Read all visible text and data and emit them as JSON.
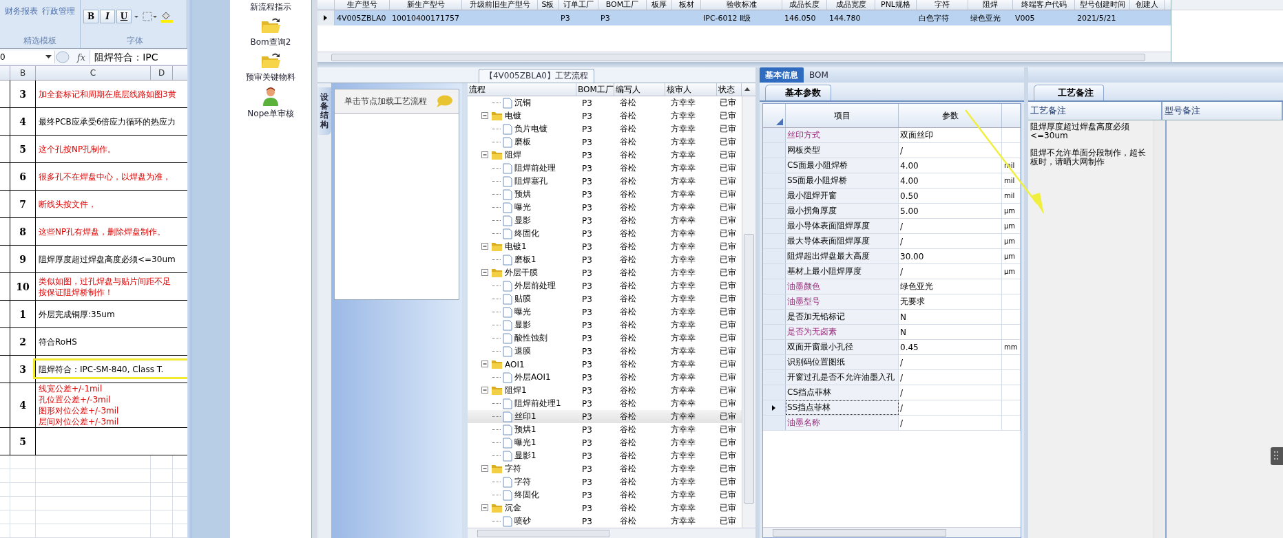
{
  "spreadsheet": {
    "ribbon": {
      "templates": {
        "items": [
          "财务报表",
          "行政管理"
        ],
        "label": "精选模板"
      },
      "font": {
        "buttons": [
          "B",
          "I",
          "U"
        ],
        "label": "字体"
      }
    },
    "name_box": "0",
    "formula_icon": "fx",
    "formula": "阻焊符合：IPC",
    "columns": [
      "B",
      "C",
      "D"
    ],
    "rows": [
      {
        "number": "3",
        "lines": [
          "加全套标记和周期在底层线路如图3黄"
        ],
        "important": true,
        "highlighted": false
      },
      {
        "number": "4",
        "lines": [
          "最终PCB应承受6倍应力循环的热应力"
        ],
        "important": false,
        "highlighted": false
      },
      {
        "number": "5",
        "lines": [
          "这个孔按NP孔制作。"
        ],
        "important": true,
        "highlighted": false
      },
      {
        "number": "6",
        "lines": [
          "很多孔不在焊盘中心，以焊盘为准，"
        ],
        "important": true,
        "highlighted": false
      },
      {
        "number": "7",
        "lines": [
          "断线头按文件，"
        ],
        "important": true,
        "highlighted": false
      },
      {
        "number": "8",
        "lines": [
          "这些NP孔有焊盘，删除焊盘制作。"
        ],
        "important": true,
        "highlighted": false
      },
      {
        "number": "9",
        "lines": [
          "阻焊厚度超过焊盘高度必须<=30um"
        ],
        "important": false,
        "highlighted": false
      },
      {
        "number": "10",
        "lines": [
          "类似如图，过孔焊盘与贴片间距不足",
          "按保证阻焊桥制作！"
        ],
        "important": true,
        "highlighted": false
      },
      {
        "number": "1",
        "lines": [
          "外层完成铜厚:35um"
        ],
        "important": false,
        "highlighted": false
      },
      {
        "number": "2",
        "lines": [
          "符合RoHS"
        ],
        "important": false,
        "highlighted": false
      },
      {
        "number": "3",
        "lines": [
          "阻焊符合：IPC-SM-840, Class T."
        ],
        "important": false,
        "highlighted": true
      },
      {
        "number": "4",
        "lines": [
          "线宽公差+/-1mil",
          "孔位置公差+/-3mil",
          "图形对位公差+/-3mil",
          "层间对位公差+/-3mil"
        ],
        "important": true,
        "highlighted": false
      },
      {
        "number": "5",
        "highlighted": false
      }
    ]
  },
  "launcher": [
    {
      "label": "新流程指示",
      "kind": "label"
    },
    {
      "label": "Bom查询2",
      "kind": "folder"
    },
    {
      "label": "预审关键物料",
      "kind": "folder"
    },
    {
      "label": "Nope单审核",
      "kind": "user"
    }
  ],
  "model_grid": {
    "columns": [
      "生产型号",
      "新生产型号",
      "升级前旧生产型号",
      "S板",
      "订单工厂",
      "BOM工厂",
      "板厚",
      "板材",
      "验收标准",
      "成品长度",
      "成品宽度",
      "PNL规格",
      "字符",
      "阻焊",
      "终端客户代码",
      "型号创建时间",
      "创建人"
    ],
    "rows": [
      {
        "selected": true,
        "cells": [
          "4V005ZBLA0",
          "10010400171757",
          null,
          null,
          "P3",
          "P3",
          null,
          null,
          "IPC-6012 Ⅱ级",
          "146.050",
          "144.780",
          null,
          "白色字符",
          "绿色亚光",
          "V005",
          "2021/5/21",
          null
        ]
      }
    ]
  },
  "process_panel": {
    "title": "【4V005ZBLA0】工艺流程",
    "side_tab": "设备结构",
    "hint": "单击节点加载工艺流程",
    "columns": [
      "流程",
      "BOM工厂",
      "编写人",
      "核审人",
      "状态"
    ],
    "tree": [
      {
        "name": "沉铜",
        "kind": "step",
        "bom": "P3",
        "author": "谷松",
        "reviewer": "方幸幸",
        "status": "已审",
        "selected": false
      },
      {
        "name": "电镀",
        "kind": "group",
        "expanded": true,
        "bom": "P3",
        "author": "谷松",
        "reviewer": "方幸幸",
        "status": "已审",
        "selected": false,
        "children": [
          {
            "name": "负片电镀",
            "kind": "step",
            "bom": "P3",
            "author": "谷松",
            "reviewer": "方幸幸",
            "status": "已审",
            "selected": false
          },
          {
            "name": "磨板",
            "kind": "step",
            "bom": "P3",
            "author": "谷松",
            "reviewer": "方幸幸",
            "status": "已审",
            "selected": false
          }
        ]
      },
      {
        "name": "阻焊",
        "kind": "group",
        "expanded": true,
        "bom": "P3",
        "author": "谷松",
        "reviewer": "方幸幸",
        "status": "已审",
        "selected": false,
        "children": [
          {
            "name": "阻焊前处理",
            "kind": "step",
            "bom": "P3",
            "author": "谷松",
            "reviewer": "方幸幸",
            "status": "已审",
            "selected": false
          },
          {
            "name": "阻焊塞孔",
            "kind": "step",
            "bom": "P3",
            "author": "谷松",
            "reviewer": "方幸幸",
            "status": "已审",
            "selected": false
          },
          {
            "name": "预烘",
            "kind": "step",
            "bom": "P3",
            "author": "谷松",
            "reviewer": "方幸幸",
            "status": "已审",
            "selected": false
          },
          {
            "name": "曝光",
            "kind": "step",
            "bom": "P3",
            "author": "谷松",
            "reviewer": "方幸幸",
            "status": "已审",
            "selected": false
          },
          {
            "name": "显影",
            "kind": "step",
            "bom": "P3",
            "author": "谷松",
            "reviewer": "方幸幸",
            "status": "已审",
            "selected": false
          },
          {
            "name": "终固化",
            "kind": "step",
            "bom": "P3",
            "author": "谷松",
            "reviewer": "方幸幸",
            "status": "已审",
            "selected": false
          }
        ]
      },
      {
        "name": "电镀1",
        "kind": "group",
        "expanded": true,
        "bom": "P3",
        "author": "谷松",
        "reviewer": "方幸幸",
        "status": "已审",
        "selected": false,
        "children": [
          {
            "name": "磨板1",
            "kind": "step",
            "bom": "P3",
            "author": "谷松",
            "reviewer": "方幸幸",
            "status": "已审",
            "selected": false
          }
        ]
      },
      {
        "name": "外层干膜",
        "kind": "group",
        "expanded": true,
        "bom": "P3",
        "author": "谷松",
        "reviewer": "方幸幸",
        "status": "已审",
        "selected": false,
        "children": [
          {
            "name": "外层前处理",
            "kind": "step",
            "bom": "P3",
            "author": "谷松",
            "reviewer": "方幸幸",
            "status": "已审",
            "selected": false
          },
          {
            "name": "贴膜",
            "kind": "step",
            "bom": "P3",
            "author": "谷松",
            "reviewer": "方幸幸",
            "status": "已审",
            "selected": false
          },
          {
            "name": "曝光",
            "kind": "step",
            "bom": "P3",
            "author": "谷松",
            "reviewer": "方幸幸",
            "status": "已审",
            "selected": false
          },
          {
            "name": "显影",
            "kind": "step",
            "bom": "P3",
            "author": "谷松",
            "reviewer": "方幸幸",
            "status": "已审",
            "selected": false
          },
          {
            "name": "酸性蚀刻",
            "kind": "step",
            "bom": "P3",
            "author": "谷松",
            "reviewer": "方幸幸",
            "status": "已审",
            "selected": false
          },
          {
            "name": "退膜",
            "kind": "step",
            "bom": "P3",
            "author": "谷松",
            "reviewer": "方幸幸",
            "status": "已审",
            "selected": false
          }
        ]
      },
      {
        "name": "AOI1",
        "kind": "group",
        "expanded": true,
        "bom": "P3",
        "author": "谷松",
        "reviewer": "方幸幸",
        "status": "已审",
        "selected": false,
        "children": [
          {
            "name": "外层AOI1",
            "kind": "step",
            "bom": "P3",
            "author": "谷松",
            "reviewer": "方幸幸",
            "status": "已审",
            "selected": false
          }
        ]
      },
      {
        "name": "阻焊1",
        "kind": "group",
        "expanded": true,
        "bom": "P3",
        "author": "谷松",
        "reviewer": "方幸幸",
        "status": "已审",
        "selected": false,
        "children": [
          {
            "name": "阻焊前处理1",
            "kind": "step",
            "bom": "P3",
            "author": "谷松",
            "reviewer": "方幸幸",
            "status": "已审",
            "selected": false
          },
          {
            "name": "丝印1",
            "kind": "step",
            "bom": "P3",
            "author": "谷松",
            "reviewer": "方幸幸",
            "status": "已审",
            "selected": true
          },
          {
            "name": "预烘1",
            "kind": "step",
            "bom": "P3",
            "author": "谷松",
            "reviewer": "方幸幸",
            "status": "已审",
            "selected": false
          },
          {
            "name": "曝光1",
            "kind": "step",
            "bom": "P3",
            "author": "谷松",
            "reviewer": "方幸幸",
            "status": "已审",
            "selected": false
          },
          {
            "name": "显影1",
            "kind": "step",
            "bom": "P3",
            "author": "谷松",
            "reviewer": "方幸幸",
            "status": "已审",
            "selected": false
          }
        ]
      },
      {
        "name": "字符",
        "kind": "group",
        "expanded": true,
        "bom": "P3",
        "author": "谷松",
        "reviewer": "方幸幸",
        "status": "已审",
        "selected": false,
        "children": [
          {
            "name": "字符",
            "kind": "step",
            "bom": "P3",
            "author": "谷松",
            "reviewer": "方幸幸",
            "status": "已审",
            "selected": false
          },
          {
            "name": "终固化",
            "kind": "step",
            "bom": "P3",
            "author": "谷松",
            "reviewer": "方幸幸",
            "status": "已审",
            "selected": false
          }
        ]
      },
      {
        "name": "沉金",
        "kind": "group",
        "expanded": true,
        "bom": "P3",
        "author": "谷松",
        "reviewer": "方幸幸",
        "status": "已审",
        "selected": false,
        "children": [
          {
            "name": "喷砂",
            "kind": "step",
            "bom": "P3",
            "author": "谷松",
            "reviewer": "方幸幸",
            "status": "已审",
            "selected": false
          }
        ]
      }
    ]
  },
  "info_tabs": [
    {
      "label": "基本信息",
      "selected": true
    },
    {
      "label": "BOM",
      "selected": false
    }
  ],
  "params": {
    "tab": "基本参数",
    "columns": [
      "项目",
      "参数"
    ],
    "rows": [
      {
        "item": "丝印方式",
        "value": "双面丝印",
        "highlighted": true,
        "selected": false
      },
      {
        "item": "网板类型",
        "value": "/",
        "highlighted": false,
        "selected": false
      },
      {
        "item": "CS面最小阻焊桥",
        "value": "4.00",
        "unit": "mil",
        "highlighted": false,
        "selected": false
      },
      {
        "item": "SS面最小阻焊桥",
        "value": "4.00",
        "unit": "mil",
        "highlighted": false,
        "selected": false
      },
      {
        "item": "最小阻焊开窗",
        "value": "0.50",
        "unit": "mil",
        "highlighted": false,
        "selected": false
      },
      {
        "item": "最小拐角厚度",
        "value": "5.00",
        "unit": "μm",
        "highlighted": false,
        "selected": false
      },
      {
        "item": "最小导体表面阻焊厚度",
        "value": "/",
        "unit": "μm",
        "highlighted": false,
        "selected": false
      },
      {
        "item": "最大导体表面阻焊厚度",
        "value": "/",
        "unit": "μm",
        "highlighted": false,
        "selected": false
      },
      {
        "item": "阻焊超出焊盘最大高度",
        "value": "30.00",
        "unit": "μm",
        "highlighted": false,
        "selected": false
      },
      {
        "item": "基材上最小阻焊厚度",
        "value": "/",
        "unit": "μm",
        "highlighted": false,
        "selected": false
      },
      {
        "item": "油墨颜色",
        "value": "绿色亚光",
        "highlighted": true,
        "selected": false
      },
      {
        "item": "油墨型号",
        "value": "无要求",
        "highlighted": true,
        "selected": false
      },
      {
        "item": "是否加无铅标记",
        "value": "N",
        "highlighted": false,
        "selected": false
      },
      {
        "item": "是否为无卤素",
        "value": "N",
        "highlighted": true,
        "selected": false
      },
      {
        "item": "双面开窗最小孔径",
        "value": "0.45",
        "unit": "mm",
        "highlighted": false,
        "selected": false
      },
      {
        "item": "识别码位置图纸",
        "value": "/",
        "highlighted": false,
        "selected": false
      },
      {
        "item": "开窗过孔是否不允许油墨入孔",
        "value": "/",
        "highlighted": false,
        "selected": false
      },
      {
        "item": "CS挡点菲林",
        "value": "/",
        "highlighted": false,
        "selected": false
      },
      {
        "item": "SS挡点菲林",
        "value": "/",
        "highlighted": false,
        "selected": true
      },
      {
        "item": "油墨名称",
        "value": "/",
        "highlighted": true,
        "selected": false
      }
    ]
  },
  "notes": {
    "tab": "工艺备注",
    "columns": [
      "工艺备注",
      "型号备注"
    ],
    "paragraphs": [
      "阻焊厚度超过焊盘高度必须<=30um",
      "阻焊不允许单面分段制作，超长板时，请晒大网制作"
    ]
  }
}
